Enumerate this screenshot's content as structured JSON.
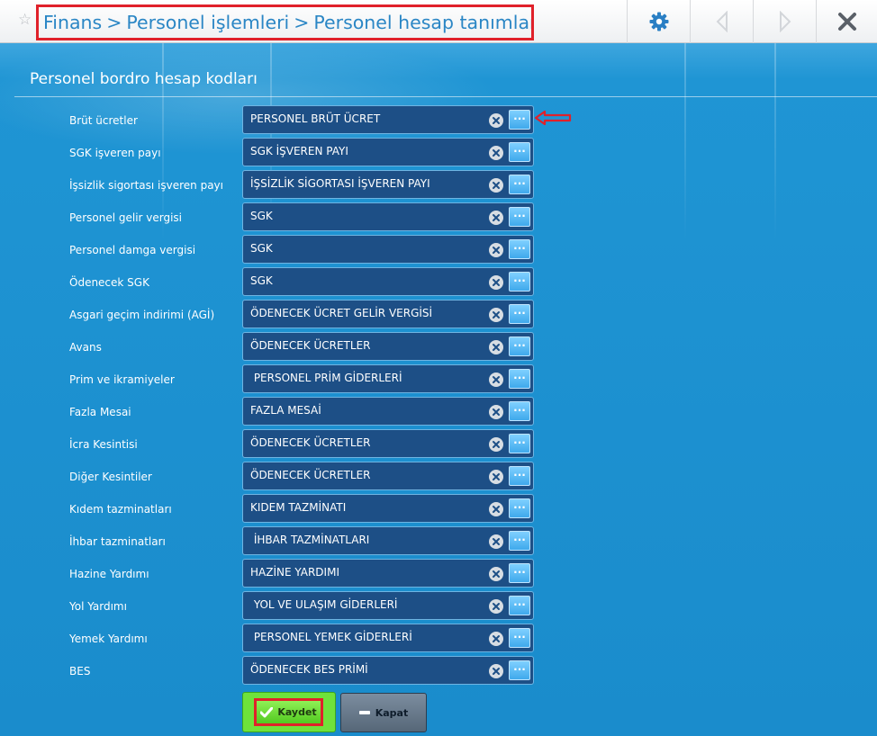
{
  "breadcrumb": {
    "items": [
      "Finans",
      "Personel işlemleri",
      "Personel hesap tanımları"
    ],
    "separator": ">"
  },
  "toolbar": {
    "settings_icon": "gear-icon",
    "prev_icon": "chevron-left-icon",
    "next_icon": "chevron-right-icon",
    "close_icon": "close-x-icon"
  },
  "section": {
    "title": "Personel bordro hesap kodları"
  },
  "rows": [
    {
      "label": "Brüt ücretler",
      "value": "PERSONEL BRÜT ÜCRET"
    },
    {
      "label": "SGK işveren payı",
      "value": "SGK İŞVEREN PAYI"
    },
    {
      "label": "İşsizlik sigortası işveren payı",
      "value": "İŞSİZLİK SİGORTASI İŞVEREN PAYI"
    },
    {
      "label": "Personel gelir vergisi",
      "value": "SGK"
    },
    {
      "label": "Personel damga vergisi",
      "value": "SGK"
    },
    {
      "label": "Ödenecek SGK",
      "value": "SGK"
    },
    {
      "label": "Asgari geçim indirimi (AGİ)",
      "value": "ÖDENECEK ÜCRET GELİR VERGİSİ"
    },
    {
      "label": "Avans",
      "value": "ÖDENECEK ÜCRETLER"
    },
    {
      "label": "Prim ve ikramiyeler",
      "value": " PERSONEL PRİM GİDERLERİ"
    },
    {
      "label": "Fazla Mesai",
      "value": "FAZLA MESAİ"
    },
    {
      "label": "İcra Kesintisi",
      "value": "ÖDENECEK ÜCRETLER"
    },
    {
      "label": "Diğer Kesintiler",
      "value": "ÖDENECEK ÜCRETLER"
    },
    {
      "label": "Kıdem tazminatları",
      "value": "KIDEM TAZMİNATI"
    },
    {
      "label": "İhbar tazminatları",
      "value": " İHBAR TAZMİNATLARI"
    },
    {
      "label": "Hazine Yardımı",
      "value": "HAZİNE YARDIMI"
    },
    {
      "label": "Yol Yardımı",
      "value": " YOL VE ULAŞIM GİDERLERİ"
    },
    {
      "label": "Yemek Yardımı",
      "value": " PERSONEL YEMEK GİDERLERİ"
    },
    {
      "label": "BES",
      "value": "ÖDENECEK BES PRİMİ"
    }
  ],
  "browse_label": "...",
  "buttons": {
    "save": "Kaydet",
    "close": "Kapat"
  },
  "colors": {
    "background": "#1c8fd0",
    "field": "#1d4f86",
    "highlight": "#e0212a",
    "save": "#6fe23b"
  }
}
